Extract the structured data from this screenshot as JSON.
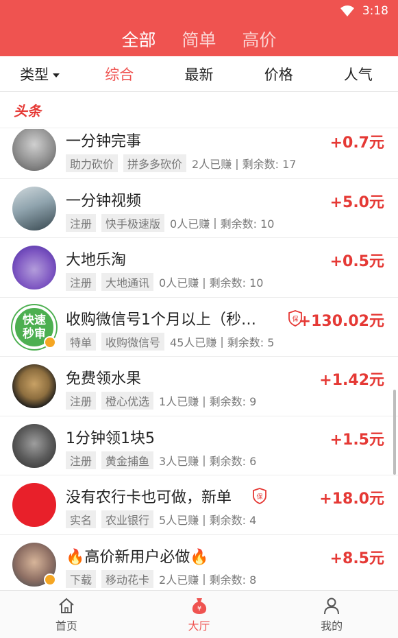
{
  "status_bar": {
    "time": "3:18"
  },
  "header": {
    "tabs": [
      {
        "label": "全部"
      },
      {
        "label": "简单"
      },
      {
        "label": "高价"
      }
    ]
  },
  "filters": [
    {
      "label": "类型"
    },
    {
      "label": "综合"
    },
    {
      "label": "最新"
    },
    {
      "label": "价格"
    },
    {
      "label": "人气"
    }
  ],
  "headline": {
    "label": "头条"
  },
  "tasks": [
    {
      "title": "一分钟完事",
      "tags": [
        "助力砍价",
        "拼多多砍价"
      ],
      "earned": "2人已赚",
      "remaining": "剩余数: 17",
      "price": "+0.7元"
    },
    {
      "title": "一分钟视频",
      "tags": [
        "注册",
        "快手极速版"
      ],
      "earned": "0人已赚",
      "remaining": "剩余数: 10",
      "price": "+5.0元"
    },
    {
      "title": "大地乐淘",
      "tags": [
        "注册",
        "大地通讯"
      ],
      "earned": "0人已赚",
      "remaining": "剩余数: 10",
      "price": "+0.5元"
    },
    {
      "title": "收购微信号1个月以上（秒…",
      "tags": [
        "特单",
        "收购微信号"
      ],
      "earned": "45人已赚",
      "remaining": "剩余数: 5",
      "price": "+130.02元",
      "avatar_text": "快速秒审"
    },
    {
      "title": "免费领水果",
      "tags": [
        "注册",
        "橙心优选"
      ],
      "earned": "1人已赚",
      "remaining": "剩余数: 9",
      "price": "+1.42元"
    },
    {
      "title": "1分钟领1块5",
      "tags": [
        "注册",
        "黄金捕鱼"
      ],
      "earned": "3人已赚",
      "remaining": "剩余数: 6",
      "price": "+1.5元"
    },
    {
      "title": "没有农行卡也可做，新单",
      "tags": [
        "实名",
        "农业银行"
      ],
      "earned": "5人已赚",
      "remaining": "剩余数: 4",
      "price": "+18.0元"
    },
    {
      "title": "🔥高价新用户必做🔥",
      "tags": [
        "下载",
        "移动花卡"
      ],
      "earned": "2人已赚",
      "remaining": "剩余数: 8",
      "price": "+8.5元"
    }
  ],
  "bottom_nav": [
    {
      "label": "首页"
    },
    {
      "label": "大厅"
    },
    {
      "label": "我的"
    }
  ],
  "colors": {
    "brand": "#ef5350",
    "price": "#e53935"
  }
}
